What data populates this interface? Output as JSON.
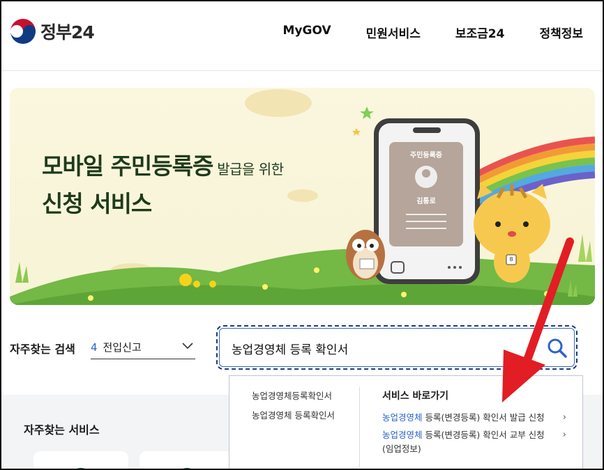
{
  "header": {
    "logo_text": "정부24",
    "nav": [
      "MyGOV",
      "민원서비스",
      "보조금24",
      "정책정보"
    ]
  },
  "banner": {
    "title_line1_main": "모바일 주민등록증",
    "title_line1_small": " 발급을 위한",
    "title_line2": "신청 서비스",
    "phone_card_title": "주민등록증",
    "phone_card_name": "김통로",
    "mascot_badge": "8"
  },
  "search": {
    "freq_label": "자주찾는 검색",
    "freq_number": "4",
    "freq_value": "전입신고",
    "query": "농업경영체 등록 확인서"
  },
  "dropdown": {
    "suggestions": [
      "농업경영체등록확인서",
      "농업경영체 등록확인서"
    ],
    "shortcut_heading": "서비스 바로가기",
    "links": [
      {
        "highlight": "농업경영체",
        "rest": " 등록(변경등록) 확인서 발급 신청"
      },
      {
        "highlight": "농업경영체",
        "rest": " 등록(변경등록) 확인서 교부 신청 (임업정보)"
      }
    ]
  },
  "services": {
    "title": "자주찾는 서비스"
  },
  "colors": {
    "accent_blue": "#2c62c9",
    "focus_navy": "#1f3a77",
    "banner_green": "#1e3a1c",
    "arrow_red": "#e21d24"
  }
}
